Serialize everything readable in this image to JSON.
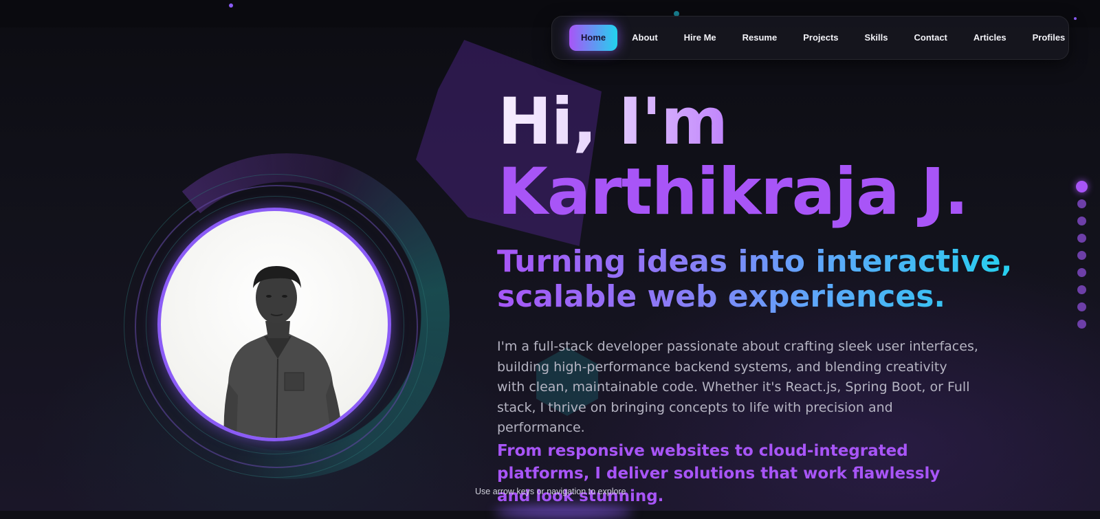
{
  "nav": {
    "items": [
      {
        "label": "Home",
        "active": true
      },
      {
        "label": "About",
        "active": false
      },
      {
        "label": "Hire Me",
        "active": false
      },
      {
        "label": "Resume",
        "active": false
      },
      {
        "label": "Projects",
        "active": false
      },
      {
        "label": "Skills",
        "active": false
      },
      {
        "label": "Contact",
        "active": false
      },
      {
        "label": "Articles",
        "active": false
      },
      {
        "label": "Profiles",
        "active": false
      }
    ]
  },
  "hero": {
    "greeting": "Hi, I'm",
    "name": "Karthikraja J.",
    "tagline_line1": "Turning ideas into interactive,",
    "tagline_line2": "scalable web experiences.",
    "description": "I'm a full-stack developer passionate about crafting sleek user interfaces, building high-performance backend systems, and blending creativity with clean, maintainable code. Whether it's React.js, Spring Boot, or Full stack, I thrive on bringing concepts to life with precision and performance.",
    "description2": "From responsive websites to cloud-integrated platforms, I deliver solutions that work flawlessly and look stunning."
  },
  "footer": {
    "hint": "Use arrow keys or navigation to explore"
  },
  "section_dots": {
    "count": 9,
    "active_index": 0
  },
  "colors": {
    "accent_purple": "#a855f7",
    "accent_cyan": "#22d3ee",
    "background": "#0f0f16"
  }
}
